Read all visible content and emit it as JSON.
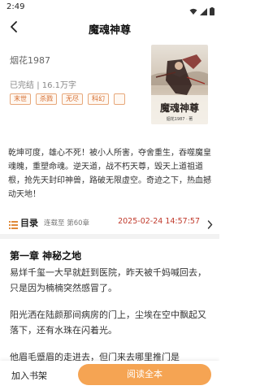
{
  "status_bar": {
    "time": "2:49"
  },
  "top_bar": {
    "title": "魔魂神尊"
  },
  "book": {
    "author": "烟花1987",
    "status": "已完结",
    "word_count": "16.1万字",
    "tags": [
      "末世",
      "杀戮",
      "无尽",
      "科幻"
    ],
    "cover": {
      "title": "魔魂神尊",
      "author": "烟花1987 · 著"
    },
    "synopsis": "乾坤可度，雄心不死！被小人所害，夺舍重生，吞噬魔皇魂魄，重塑命魂。逆天道，战不朽天尊，毁天上道祖道根，抢先天封印神兽，路破无限虚空。奇迹之下，热血撼动天地！"
  },
  "toc": {
    "label": "目录",
    "status": "连载至 第60章",
    "updated": "2025-02-24 14:57:57"
  },
  "chapter": {
    "title": "第一章 神秘之地",
    "paragraphs": [
      "易烊千玺一大早就赶到医院，昨天被千妈喊回去，只是因为楠楠突然感冒了。",
      "阳光洒在陆颜那间病房的门上，尘埃在空中飘起又落下，还有水珠在闪着光。",
      "他眉毛蹙眉的走进去，但门来去哪里推门是"
    ]
  },
  "bottom_bar": {
    "add_shelf": "加入书架",
    "read_all": "阅读全本"
  },
  "colors": {
    "accent": "#f5a453",
    "tag_text": "#d46a2a",
    "date": "#c0392b"
  }
}
